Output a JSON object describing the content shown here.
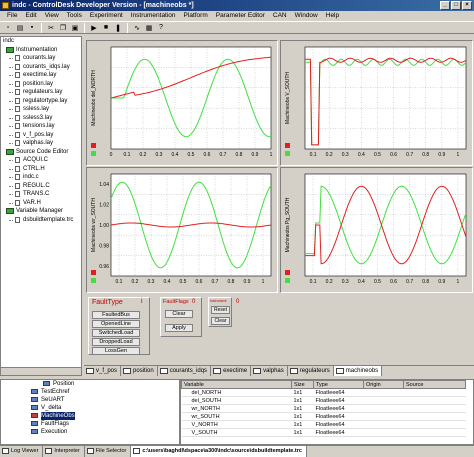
{
  "window": {
    "title": "indc - ControlDesk Developer Version - [machineobs *]"
  },
  "menu": [
    {
      "label": "File"
    },
    {
      "label": "Edit"
    },
    {
      "label": "View"
    },
    {
      "label": "Tools"
    },
    {
      "label": "Experiment"
    },
    {
      "label": "Instrumentation"
    },
    {
      "label": "Platform"
    },
    {
      "label": "Parameter Editor"
    },
    {
      "label": "CAN"
    },
    {
      "label": "Window"
    },
    {
      "label": "Help"
    }
  ],
  "tree": {
    "root": "indc",
    "instrumentation_label": "Instrumentation",
    "instrumentation_items": [
      "courants.lay",
      "courants_idqs.lay",
      "exectime.lay",
      "position.lay",
      "regulateurs.lay",
      "regulatortype.lay",
      "ssless.lay",
      "ssless3.lay",
      "tensions.lay",
      "v_f_pos.lay",
      "valphas.lay"
    ],
    "source_label": "Source Code Editor",
    "source_items": [
      "ACQUI.C",
      "CTRL.H",
      "indc.c",
      "REGUL.C",
      "TRANS.C",
      "VAR.H"
    ],
    "variable_label": "Variable Manager",
    "variable_items": [
      "dsbuildtemplate.trc"
    ]
  },
  "plots": {
    "ylabel_tl": "Machineobs del_NORTH",
    "ylabel_tr": "Machineobs V_SOUTH",
    "ylabel_bl": "Machineobs wr_SOUTH",
    "ylabel_br": "Machineobs Pg_SOUTH",
    "xticks": [
      "0.1",
      "0.2",
      "0.3",
      "0.4",
      "0.5",
      "0.6",
      "0.7",
      "0.8",
      "0.9",
      "1"
    ],
    "xticks_tl": [
      "0",
      "0.1",
      "0.2",
      "0.3",
      "0.4",
      "0.5",
      "0.6",
      "0.7",
      "0.8",
      "0.9",
      "1"
    ],
    "yticks_bl": [
      "1.04",
      "1.02",
      "1.00",
      "0.98",
      "0.96"
    ],
    "colors": {
      "green": "#40e040",
      "red": "#e02020",
      "grid": "#808080"
    }
  },
  "faults": {
    "faulttype_title": "FaultType",
    "faulttype_buttons": [
      "FaultedBus",
      "OpenedLine",
      "SwitchedLoad",
      "DroppedLoad",
      "LossGen"
    ],
    "faultflags_title": "FaultFlags",
    "faultflags_led": "0",
    "faultflags_buttons": [
      "Clear",
      "Apply"
    ],
    "third_title": "Instrument",
    "third_led": "0",
    "third_buttons": [
      "Reset",
      "Clear"
    ],
    "faulttype_led": "i"
  },
  "tabs": [
    "v_f_pos",
    "position",
    "courants_idqs",
    "exectime",
    "valphas",
    "regulateurs",
    "machineobs"
  ],
  "bottom_tree": {
    "items": [
      "Position",
      "TestEchref",
      "SeUART",
      "V_delta",
      "MachineObs",
      "FaultFlags",
      "Execution"
    ]
  },
  "var_table": {
    "headers": [
      "Variable",
      "Size",
      "Type",
      "Origin",
      "Source"
    ],
    "rows": [
      [
        "del_NORTH",
        "1x1",
        "FloatIeee64",
        "",
        ""
      ],
      [
        "del_SOUTH",
        "1x1",
        "FloatIeee64",
        "",
        ""
      ],
      [
        "wr_NORTH",
        "1x1",
        "FloatIeee64",
        "",
        ""
      ],
      [
        "wr_SOUTH",
        "1x1",
        "FloatIeee64",
        "",
        ""
      ],
      [
        "V_NORTH",
        "1x1",
        "FloatIeee64",
        "",
        ""
      ],
      [
        "V_SOUTH",
        "1x1",
        "FloatIeee64",
        "",
        ""
      ]
    ]
  },
  "footer": {
    "tabs": [
      "Log Viewer",
      "Interpreter",
      "File Selector",
      "c:\\users\\baghdl\\dspace\\a300\\indc\\source\\dsbuildtemplate.trc"
    ]
  }
}
